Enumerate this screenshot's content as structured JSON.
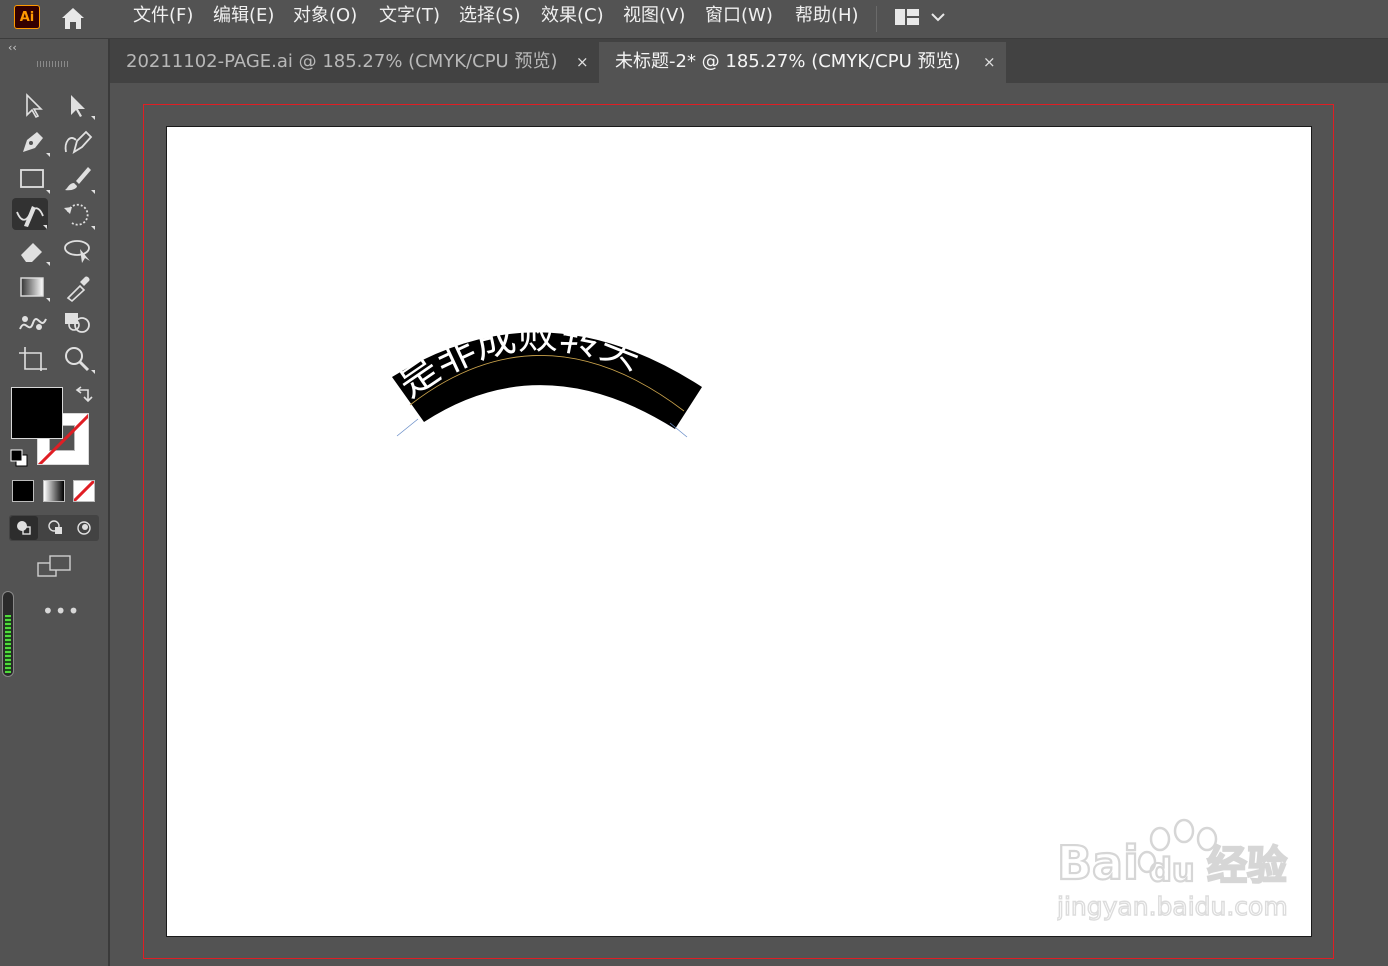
{
  "app": {
    "logo": "Ai"
  },
  "menu": [
    {
      "label": "文件(F)"
    },
    {
      "label": "编辑(E)"
    },
    {
      "label": "对象(O)"
    },
    {
      "label": "文字(T)"
    },
    {
      "label": "选择(S)"
    },
    {
      "label": "效果(C)"
    },
    {
      "label": "视图(V)"
    },
    {
      "label": "窗口(W)"
    },
    {
      "label": "帮助(H)"
    }
  ],
  "tools_panel": {
    "collapse_label": "‹‹",
    "more_label": "•••",
    "tools": [
      {
        "name": "selection-tool",
        "icon": "arrow-outline-icon"
      },
      {
        "name": "direct-selection-tool",
        "icon": "arrow-solid-icon"
      },
      {
        "name": "pen-tool",
        "icon": "pen-icon"
      },
      {
        "name": "curvature-tool",
        "icon": "curvature-pen-icon"
      },
      {
        "name": "rectangle-tool",
        "icon": "rectangle-icon"
      },
      {
        "name": "paintbrush-tool",
        "icon": "brush-icon"
      },
      {
        "name": "shaper-tool",
        "icon": "shaper-icon",
        "active": true
      },
      {
        "name": "rotate-tool",
        "icon": "rotate-icon"
      },
      {
        "name": "eraser-tool",
        "icon": "eraser-icon"
      },
      {
        "name": "lasso-tool",
        "icon": "lasso-icon"
      },
      {
        "name": "gradient-tool",
        "icon": "gradient-icon"
      },
      {
        "name": "eyedropper-tool",
        "icon": "eyedropper-icon"
      },
      {
        "name": "puppet-warp-tool",
        "icon": "puppet-warp-icon"
      },
      {
        "name": "shape-builder-tool",
        "icon": "shape-builder-icon"
      },
      {
        "name": "artboard-tool",
        "icon": "artboard-icon"
      },
      {
        "name": "zoom-tool",
        "icon": "zoom-icon"
      }
    ],
    "fill_color": "#000000",
    "stroke_color": "none"
  },
  "tabs": [
    {
      "label": "20211102-PAGE.ai @ 185.27% (CMYK/CPU 预览)",
      "close": "×",
      "active": false
    },
    {
      "label": "未标题-2* @ 185.27% (CMYK/CPU 预览)",
      "close": "×",
      "active": true
    }
  ],
  "artwork": {
    "arc_text": "是非成败转头",
    "shape_fill": "#000000",
    "text_color": "#ffffff"
  },
  "watermark": {
    "brand": "Bai",
    "brand_suffix": "du",
    "product": "经验",
    "url": "jingyan.baidu.com"
  },
  "colors": {
    "bleed_guide": "#e01e24",
    "accent": "#ff9a00",
    "ui_bg": "#535353"
  }
}
